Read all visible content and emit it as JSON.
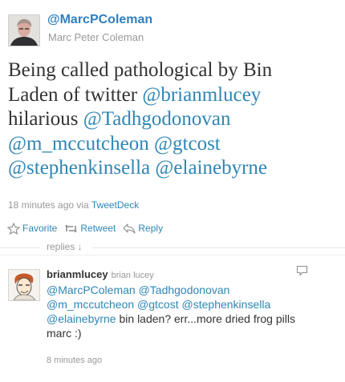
{
  "tweet": {
    "screen_name": "@MarcPColeman",
    "full_name": "Marc Peter Coleman",
    "text_parts": [
      "Being called pathological by Bin Laden of twitter ",
      "@brianmlucey",
      " hilarious ",
      "@Tadhgodonovan",
      " ",
      "@m_mccutcheon",
      " ",
      "@gtcost",
      " ",
      "@stephenkinsella",
      " ",
      "@elainebyrne"
    ],
    "time": "18 minutes ago via ",
    "source": "TweetDeck",
    "actions": {
      "favorite": "Favorite",
      "retweet": "Retweet",
      "reply": "Reply"
    },
    "colors": {
      "link": "#2f86b5",
      "name": "#2f7fbd",
      "text": "#333333",
      "muted": "#999999"
    }
  },
  "replies": {
    "label": "replies ↓",
    "items": [
      {
        "screen_name": "brianmlucey",
        "full_name": "brian lucey",
        "text_parts": [
          "@MarcPColeman",
          " ",
          "@Tadhgodonovan",
          " ",
          "@m_mccutcheon",
          " ",
          "@gtcost",
          " ",
          "@stephenkinsella",
          " ",
          "@elainebyrne",
          " bin laden? err...more dried frog pills marc :)"
        ],
        "time": "8 minutes ago",
        "reply_icon": "speech-bubble-icon"
      }
    ]
  }
}
